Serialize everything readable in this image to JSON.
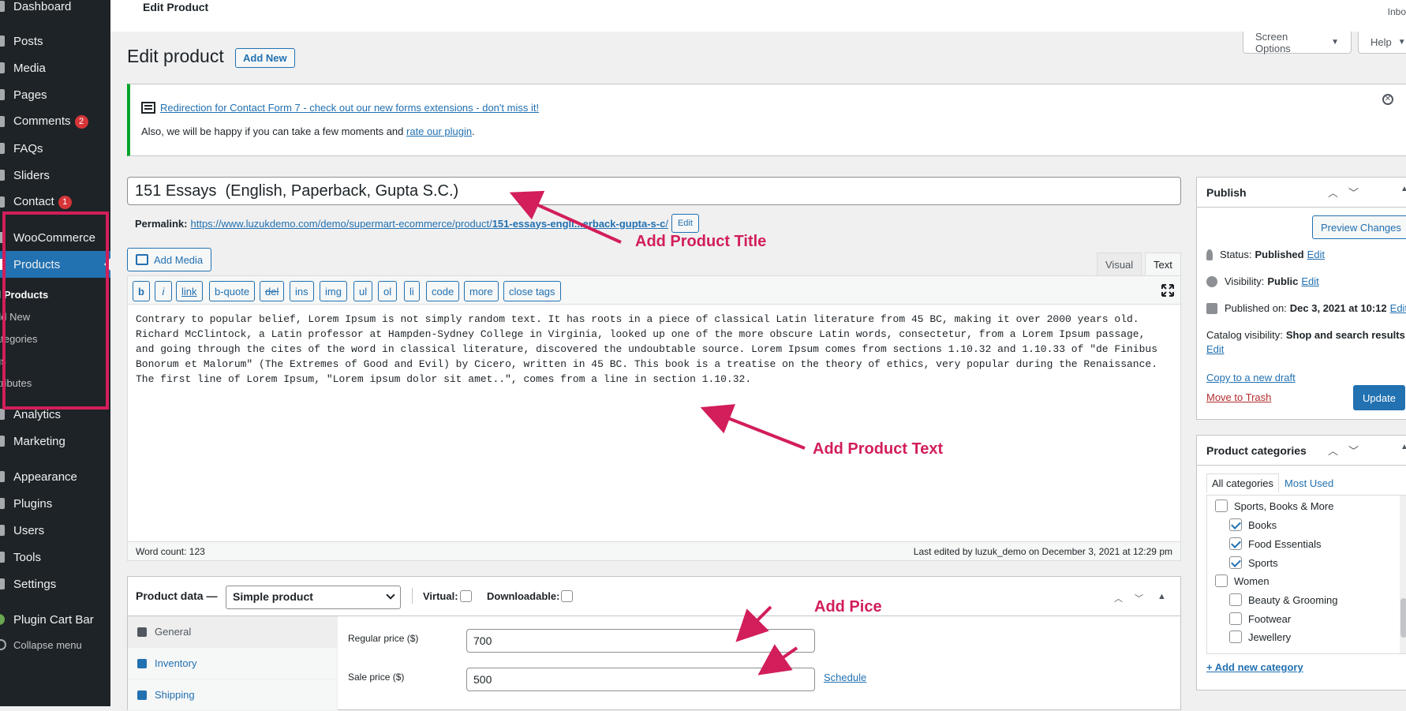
{
  "sidebar": {
    "items": [
      {
        "label": "Dashboard"
      },
      {
        "label": "Posts"
      },
      {
        "label": "Media"
      },
      {
        "label": "Pages"
      },
      {
        "label": "Comments",
        "badge": "2"
      },
      {
        "label": "FAQs"
      },
      {
        "label": "Sliders"
      },
      {
        "label": "Contact",
        "badge": "1"
      },
      {
        "label": "WooCommerce"
      },
      {
        "label": "Products"
      },
      {
        "label": "Analytics"
      },
      {
        "label": "Marketing"
      },
      {
        "label": "Appearance"
      },
      {
        "label": "Plugins"
      },
      {
        "label": "Users"
      },
      {
        "label": "Tools"
      },
      {
        "label": "Settings"
      },
      {
        "label": "Plugin Cart Bar"
      }
    ],
    "products_submenu": [
      "ll Products",
      "dd New",
      "ategories",
      "gs",
      "ttributes"
    ],
    "collapse_label": "Collapse menu"
  },
  "topbar": {
    "title": "Edit Product",
    "inbox": "Inbo"
  },
  "screen_options": {
    "label": "Screen Options"
  },
  "help": {
    "label": "Help"
  },
  "page": {
    "heading": "Edit product",
    "add_new": "Add New"
  },
  "notice": {
    "link": "Redirection for Contact Form 7 - check out our new forms extensions - don't miss it!",
    "line2_prefix": "Also, we will be happy if you can take a few moments and ",
    "line2_link": "rate our plugin",
    "line2_suffix": "."
  },
  "product": {
    "title": "151 Essays  (English, Paperback, Gupta S.C.)",
    "permalink_label": "Permalink:",
    "permalink_base": "https://www.luzukdemo.com/demo/supermart-ecommerce/product/",
    "permalink_slug": "151-essays-engli...erback-gupta-s-c",
    "permalink_end": "/",
    "edit_slug": "Edit"
  },
  "editor": {
    "add_media": "Add Media",
    "tabs": [
      "Visual",
      "Text"
    ],
    "quicktags": [
      "b",
      "i",
      "link",
      "b-quote",
      "del",
      "ins",
      "img",
      "ul",
      "ol",
      "li",
      "code",
      "more",
      "close tags"
    ],
    "content": "Contrary to popular belief, Lorem Ipsum is not simply random text. It has roots in a piece of classical Latin literature from 45 BC, making it over 2000 years old.\nRichard McClintock, a Latin professor at Hampden-Sydney College in Virginia, looked up one of the more obscure Latin words, consectetur, from a Lorem Ipsum passage,\nand going through the cites of the word in classical literature, discovered the undoubtable source. Lorem Ipsum comes from sections 1.10.32 and 1.10.33 of \"de Finibus\nBonorum et Malorum\" (The Extremes of Good and Evil) by Cicero, written in 45 BC. This book is a treatise on the theory of ethics, very popular during the Renaissance.\nThe first line of Lorem Ipsum, \"Lorem ipsum dolor sit amet..\", comes from a line in section 1.10.32.",
    "word_count": "Word count: 123",
    "last_edited": "Last edited by luzuk_demo on December 3, 2021 at 12:29 pm"
  },
  "product_data": {
    "label": "Product data —",
    "type": "Simple product",
    "virtual": "Virtual:",
    "downloadable": "Downloadable:",
    "tabs": [
      "General",
      "Inventory",
      "Shipping"
    ],
    "regular_price_label": "Regular price ($)",
    "regular_price": "700",
    "sale_price_label": "Sale price ($)",
    "sale_price": "500",
    "schedule": "Schedule"
  },
  "publish": {
    "title": "Publish",
    "preview": "Preview Changes",
    "status_label": "Status:",
    "status": "Published",
    "visibility_label": "Visibility:",
    "visibility": "Public",
    "published_label": "Published on:",
    "published": "Dec 3, 2021 at 10:12",
    "catalog_label": "Catalog visibility:",
    "catalog": "Shop and search results",
    "edit": "Edit",
    "copy_draft": "Copy to a new draft",
    "trash": "Move to Trash",
    "update": "Update"
  },
  "categories": {
    "title": "Product categories",
    "tabs": [
      "All categories",
      "Most Used"
    ],
    "items": [
      {
        "label": "Sports, Books & More",
        "checked": false
      },
      {
        "label": "Books",
        "checked": true
      },
      {
        "label": "Food Essentials",
        "checked": true
      },
      {
        "label": "Sports",
        "checked": true
      },
      {
        "label": "Women",
        "checked": false
      },
      {
        "label": "Beauty & Grooming",
        "checked": false
      },
      {
        "label": "Footwear",
        "checked": false
      },
      {
        "label": "Jewellery",
        "checked": false
      }
    ],
    "add_new": "+ Add new category"
  },
  "annotations": {
    "title": "Add Product Title",
    "text": "Add Product Text",
    "price": "Add Pice"
  },
  "colors": {
    "annotation": "#d21e5a",
    "accent": "#2271b1",
    "sidebar": "#1d2327",
    "notice_border": "#00a32a"
  }
}
